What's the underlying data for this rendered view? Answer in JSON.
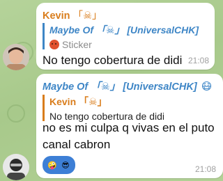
{
  "messages": [
    {
      "sender": "Kevin",
      "sender_tag": "「☠」",
      "reply": {
        "name": "Maybe Of 「☠」 [UniversalCHK]",
        "text": "Sticker",
        "icon": "angry-face-emoji"
      },
      "text": "No tengo cobertura de didi",
      "time": "21:08"
    },
    {
      "sender": "Maybe Of 「☠」 [UniversalCHK]",
      "sender_emoji": "😷",
      "reply": {
        "name": "Kevin 「☠」",
        "text": "No tengo cobertura de didi"
      },
      "text_line1": "no es mi culpa q vivas en el puto",
      "text_line2": "canal cabron",
      "reactions": [
        "🤪",
        "😎"
      ],
      "time": "21:08"
    }
  ],
  "colors": {
    "accent_orange": "#d97d1c",
    "accent_blue": "#3e86c6",
    "reaction_chip": "#3d7fd6",
    "wallpaper": "#a9c98c"
  }
}
